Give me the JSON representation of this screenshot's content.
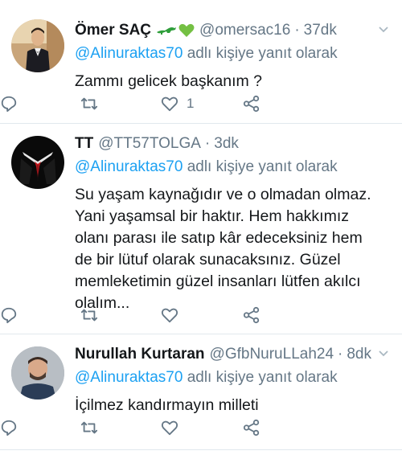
{
  "reply_prefix_suffix": "adlı kişiye yanıt olarak",
  "tweets": [
    {
      "name": "Ömer SAÇ",
      "handle": "@omersac16",
      "dot": "·",
      "time": "37dk",
      "reply_mention": "@Alinuraktas70",
      "text": "Zammı gelicek başkanım ?",
      "like_count": "1"
    },
    {
      "name": "TT",
      "handle": "@TT57TOLGA",
      "dot": "·",
      "time": "3dk",
      "reply_mention": "@Alinuraktas70",
      "text": "Su yaşam kaynağıdır ve o olmadan olmaz. Yani yaşamsal bir haktır. Hem hakkımız olanı parası ile satıp kâr edeceksiniz hem de bir lütuf olarak sunacaksınız. Güzel memleketimin güzel insanları lütfen akılcı olalım...",
      "like_count": ""
    },
    {
      "name": "Nurullah Kurtaran",
      "handle": "@GfbNuruLLah24",
      "dot": "·",
      "time": "8dk",
      "reply_mention": "@Alinuraktas70",
      "text": "İçilmez kandırmayın milleti",
      "like_count": ""
    }
  ],
  "icons": {
    "reply": "reply-icon",
    "retweet": "retweet-icon",
    "like": "heart-icon",
    "share": "share-icon",
    "caret": "chevron-down-icon"
  },
  "colors": {
    "link": "#1da1f2",
    "secondary": "#657786",
    "text": "#14171a",
    "divider": "#e1e8ed",
    "emoji_green": "#2e9e3a"
  }
}
